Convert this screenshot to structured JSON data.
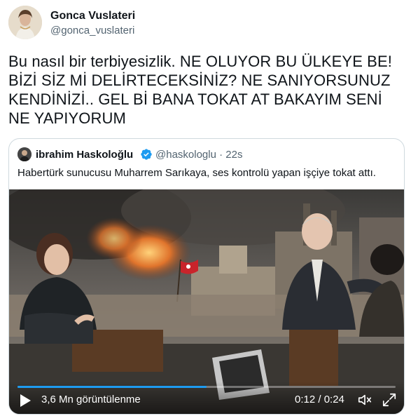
{
  "author": {
    "display_name": "Gonca Vuslateri",
    "handle": "@gonca_vuslateri",
    "avatar_icon": "profile-photo"
  },
  "tweet": {
    "text": "Bu nasıl bir terbiyesizlik. NE OLUYOR BU ÜLKEYE BE! BİZİ SİZ Mİ DELİRTECEKSİNİZ? NE SANIYORSUNUZ KENDİNİZİ.. GEL Bİ BANA TOKAT AT BAKAYIM SENİ NE YAPIYORUM"
  },
  "quoted": {
    "display_name": "ibrahim Haskoloğlu",
    "verified": true,
    "handle": "@haskologlu",
    "separator": "·",
    "time": "22s",
    "text": "Habertürk sunucusu Muharrem Sarıkaya, ses kontrolü yapan işçiye tokat attı.",
    "video": {
      "views": "3,6 Mn görüntülenme",
      "time": "0:12 / 0:24",
      "progress": 0.5,
      "play_icon": "play-icon",
      "volume_icon": "volume-icon",
      "fullscreen_icon": "fullscreen-icon"
    }
  },
  "colors": {
    "accent": "#1d9bf0",
    "text": "#0f1419",
    "secondary": "#536471",
    "border": "#cfd9de"
  }
}
